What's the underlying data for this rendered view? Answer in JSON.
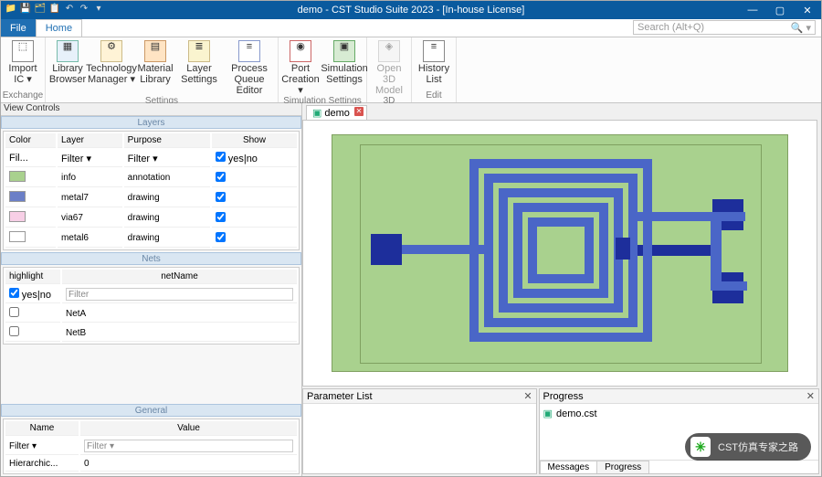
{
  "title": "demo - CST Studio Suite 2023 - [In-house License]",
  "menu": {
    "file": "File",
    "home": "Home"
  },
  "search_placeholder": "Search (Alt+Q)",
  "ribbon": {
    "exchange": {
      "lbl": "Exchange",
      "import": "Import IC ▾"
    },
    "settings": {
      "lbl": "Settings",
      "library_browser": "Library Browser",
      "tech_manager": "Technology Manager ▾",
      "mat_library": "Material Library",
      "layer_settings": "Layer Settings",
      "pq_editor": "Process Queue Editor"
    },
    "sim": {
      "lbl": "Simulation Settings",
      "port": "Port Creation ▾",
      "simset": "Simulation Settings"
    },
    "threed": {
      "lbl": "3D",
      "open3d": "Open 3D Model"
    },
    "edit": {
      "lbl": "Edit",
      "history": "History List"
    }
  },
  "doc_tab": "demo",
  "view_controls": "View Controls",
  "sections": {
    "layers": "Layers",
    "nets": "Nets",
    "general": "General"
  },
  "layers": {
    "hdr": [
      "Color",
      "Layer",
      "Purpose",
      "Show"
    ],
    "filter_hdr": "Fil...",
    "filter_layer": "Filter ▾",
    "filter_purpose": "Filter ▾",
    "filter_show": "yes|no",
    "rows": [
      {
        "color": "#a9d18e",
        "layer": "info",
        "purpose": "annotation"
      },
      {
        "color": "#6b7fc7",
        "layer": "metal7",
        "purpose": "drawing"
      },
      {
        "color": "#f7cfe6",
        "layer": "via67",
        "purpose": "drawing"
      },
      {
        "color": "#ffffff",
        "layer": "metal6",
        "purpose": "drawing"
      }
    ]
  },
  "nets": {
    "hdr": [
      "highlight",
      "netName"
    ],
    "yesno": "yes|no",
    "filter": "Filter",
    "rows": [
      "NetA",
      "NetB"
    ]
  },
  "general": {
    "hdr": [
      "Name",
      "Value"
    ],
    "filter": "Filter ▾",
    "row_name": "Hierarchic...",
    "row_val": "0"
  },
  "param_panel": "Parameter List",
  "progress_panel": "Progress",
  "progress_item": "demo.cst",
  "bot_tabs": {
    "messages": "Messages",
    "progress": "Progress"
  },
  "watermark": "CST仿真专家之路"
}
